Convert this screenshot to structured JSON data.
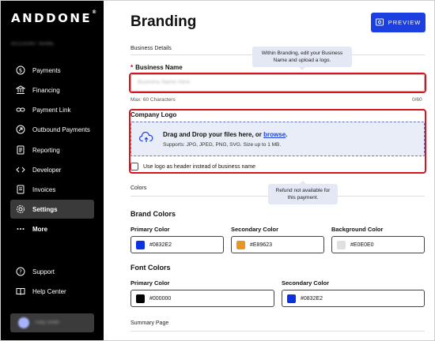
{
  "brand": {
    "logo_text": "ANDDONE",
    "logo_mark": "®",
    "account_name": "ACCOUNT NAME"
  },
  "sidebar": {
    "items": [
      {
        "label": "Payments",
        "icon": "dollar-circle-icon"
      },
      {
        "label": "Financing",
        "icon": "bank-icon"
      },
      {
        "label": "Payment Link",
        "icon": "link-icon"
      },
      {
        "label": "Outbound Payments",
        "icon": "outbound-icon"
      },
      {
        "label": "Reporting",
        "icon": "report-icon"
      },
      {
        "label": "Developer",
        "icon": "code-icon"
      },
      {
        "label": "Invoices",
        "icon": "invoice-icon"
      },
      {
        "label": "Settings",
        "icon": "gear-icon",
        "active": true
      },
      {
        "label": "More",
        "icon": "more-icon"
      }
    ],
    "footer": [
      {
        "label": "Support",
        "icon": "help-circle-icon"
      },
      {
        "label": "Help Center",
        "icon": "book-icon"
      }
    ],
    "user_name": "Tracy Smith"
  },
  "page": {
    "title": "Branding",
    "preview_label": "PREVIEW",
    "business_details_label": "Business Details",
    "business_name_label": "Business Name",
    "business_name_placeholder": "Business Name Here",
    "max_hint": "Max: 60 Characters",
    "char_count": "0/60",
    "company_logo_label": "Company Logo",
    "dropzone_title_prefix": "Drag and Drop your files here, or ",
    "dropzone_browse": "browse",
    "dropzone_title_suffix": ".",
    "dropzone_sub": "Supports: JPG, JPEG, PNG, SVG. Size up to 1 MB.",
    "checkbox_label": "Use logo as header instead of business name",
    "colors_label": "Colors",
    "brand_colors_heading": "Brand Colors",
    "font_colors_heading": "Font Colors",
    "summary_page_label": "Summary Page"
  },
  "tooltips": {
    "branding": "Within Branding, edit your Business Name and upload a logo.",
    "refund": "Refund not available for this payment."
  },
  "brand_colors": [
    {
      "label": "Primary Color",
      "value": "#0832E2",
      "swatch": "#0832E2"
    },
    {
      "label": "Secondary Color",
      "value": "#E89623",
      "swatch": "#E89623"
    },
    {
      "label": "Background Color",
      "value": "#E0E0E0",
      "swatch": "#E0E0E0"
    }
  ],
  "font_colors": [
    {
      "label": "Primary Color",
      "value": "#000000",
      "swatch": "#000000"
    },
    {
      "label": "Secondary Color",
      "value": "#0832E2",
      "swatch": "#0832E2"
    }
  ],
  "colors": {
    "accent": "#1B3FE0",
    "highlight": "#D7141D",
    "sidebar_bg": "#000000"
  }
}
